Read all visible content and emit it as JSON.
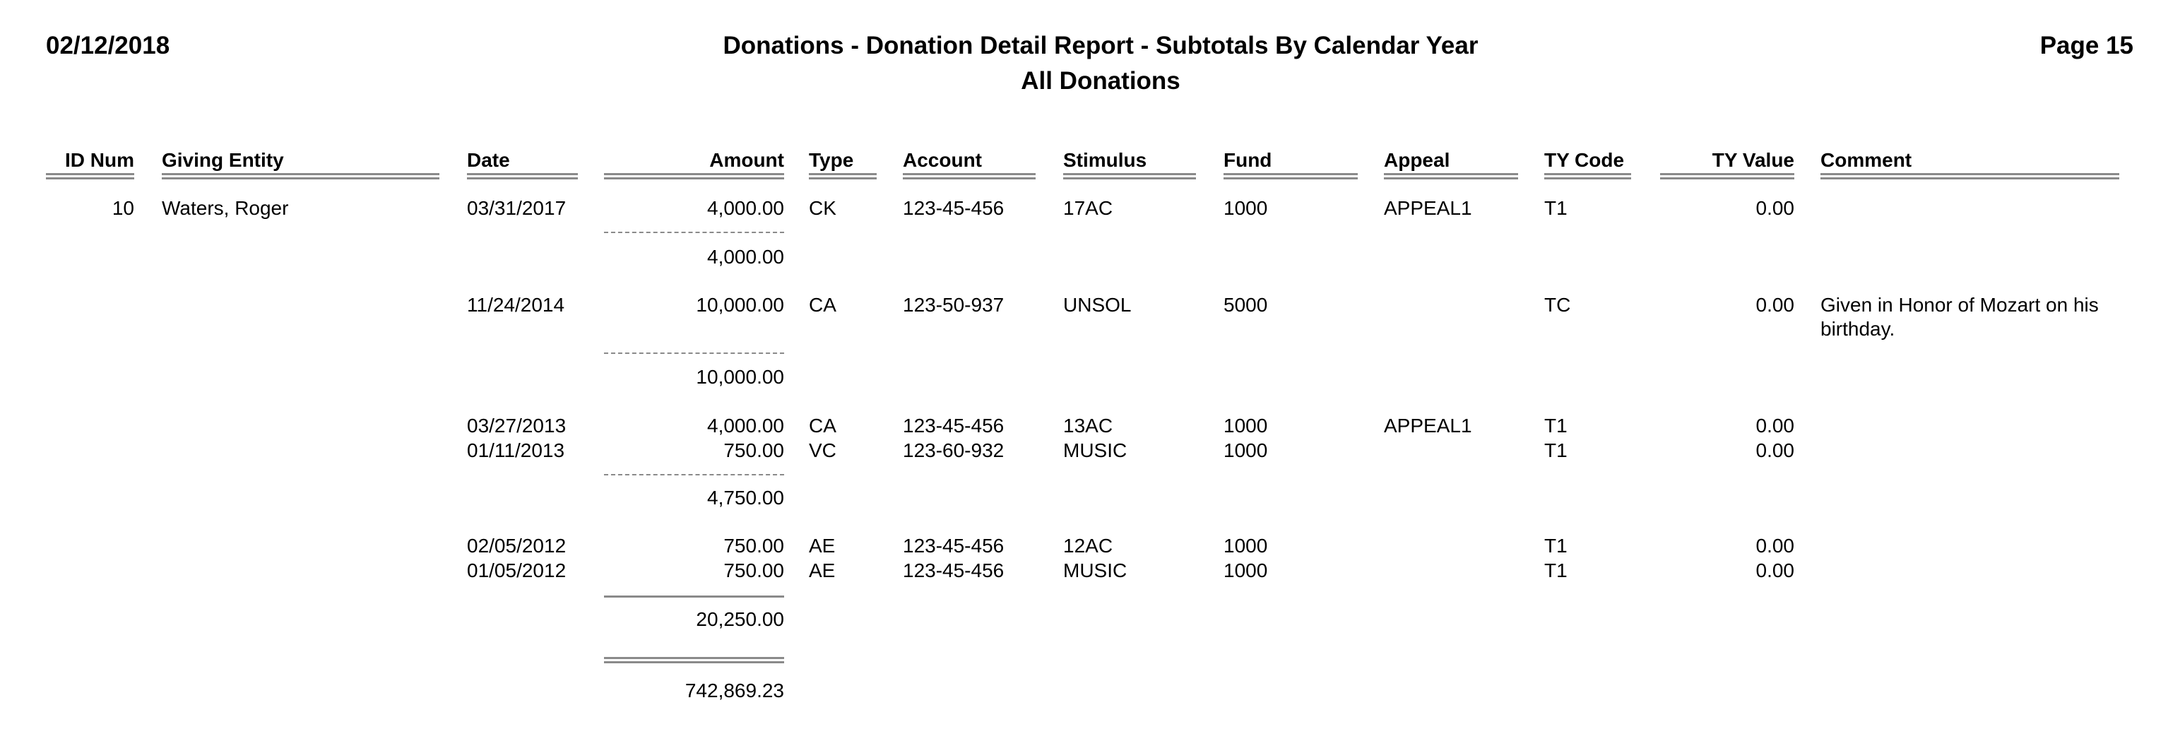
{
  "header": {
    "date": "02/12/2018",
    "title": "Donations - Donation Detail Report - Subtotals By Calendar Year",
    "subtitle": "All Donations",
    "page": "Page 15"
  },
  "columns": {
    "id_num": "ID Num",
    "giving_entity": "Giving Entity",
    "date": "Date",
    "amount": "Amount",
    "type": "Type",
    "account": "Account",
    "stimulus": "Stimulus",
    "fund": "Fund",
    "appeal": "Appeal",
    "ty_code": "TY Code",
    "ty_value": "TY Value",
    "comment": "Comment"
  },
  "donor": {
    "id_num": "10",
    "giving_entity": "Waters, Roger"
  },
  "rows": [
    {
      "date": "03/31/2017",
      "amount": "4,000.00",
      "type": "CK",
      "account": "123-45-456",
      "stimulus": "17AC",
      "fund": "1000",
      "appeal": "APPEAL1",
      "ty_code": "T1",
      "ty_value": "0.00",
      "comment": ""
    },
    {
      "date": "11/24/2014",
      "amount": "10,000.00",
      "type": "CA",
      "account": "123-50-937",
      "stimulus": "UNSOL",
      "fund": "5000",
      "appeal": "",
      "ty_code": "TC",
      "ty_value": "0.00",
      "comment": "Given in Honor of Mozart on his birthday."
    },
    {
      "date": "03/27/2013",
      "amount": "4,000.00",
      "type": "CA",
      "account": "123-45-456",
      "stimulus": "13AC",
      "fund": "1000",
      "appeal": "APPEAL1",
      "ty_code": "T1",
      "ty_value": "0.00",
      "comment": ""
    },
    {
      "date": "01/11/2013",
      "amount": "750.00",
      "type": "VC",
      "account": "123-60-932",
      "stimulus": "MUSIC",
      "fund": "1000",
      "appeal": "",
      "ty_code": "T1",
      "ty_value": "0.00",
      "comment": ""
    },
    {
      "date": "02/05/2012",
      "amount": "750.00",
      "type": "AE",
      "account": "123-45-456",
      "stimulus": "12AC",
      "fund": "1000",
      "appeal": "",
      "ty_code": "T1",
      "ty_value": "0.00",
      "comment": ""
    },
    {
      "date": "01/05/2012",
      "amount": "750.00",
      "type": "AE",
      "account": "123-45-456",
      "stimulus": "MUSIC",
      "fund": "1000",
      "appeal": "",
      "ty_code": "T1",
      "ty_value": "0.00",
      "comment": ""
    }
  ],
  "subtotals": {
    "year_2017": "4,000.00",
    "year_2014": "10,000.00",
    "year_2013": "4,750.00",
    "donor_total": "20,250.00",
    "grand_total": "742,869.23"
  }
}
